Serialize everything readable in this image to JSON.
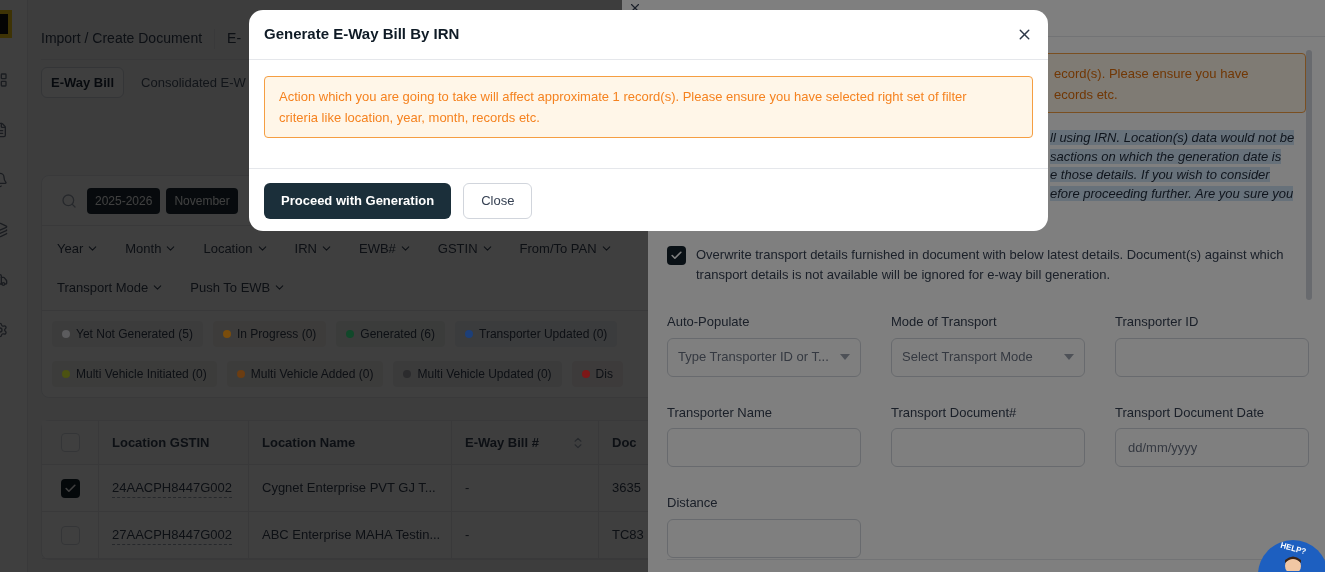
{
  "page": {
    "breadcrumb": [
      "Import / Create Document",
      "E-"
    ],
    "tabs": [
      {
        "label": "E-Way Bill",
        "selected": true
      },
      {
        "label": "Consolidated E-W",
        "selected": false
      }
    ],
    "search_chips": [
      "2025-2026",
      "November"
    ],
    "filters": [
      "Year",
      "Month",
      "Location",
      "IRN",
      "EWB#",
      "GSTIN",
      "From/To PAN",
      "Transport Mode",
      "Push To EWB"
    ],
    "statuses": [
      {
        "label": "Yet Not Generated (5)",
        "color": "#5c5c5e"
      },
      {
        "label": "In Progress (0)",
        "color": "#7a4d0c"
      },
      {
        "label": "Generated (6)",
        "color": "#11482a"
      },
      {
        "label": "Transporter Updated (0)",
        "color": "#1d3f78"
      },
      {
        "label": "Multi Vehicle Initiated (0)",
        "color": "#4c5212"
      },
      {
        "label": "Multi Vehicle Added (0)",
        "color": "#6b3d12"
      },
      {
        "label": "Multi Vehicle Updated (0)",
        "color": "#2b2b2d"
      },
      {
        "label": "Dis",
        "color": "#7d1818"
      }
    ],
    "table": {
      "header_checked": false,
      "columns": [
        {
          "label": "Location GSTIN",
          "sortable": false
        },
        {
          "label": "Location Name",
          "sortable": false
        },
        {
          "label": "E-Way Bill #",
          "sortable": true
        },
        {
          "label": "Doc",
          "sortable": false
        }
      ],
      "rows": [
        {
          "selected": true,
          "cells": [
            "24AACPH8447G002",
            "Cygnet Enterprise PVT GJ T...",
            "-",
            "3635"
          ]
        },
        {
          "selected": false,
          "cells": [
            "27AACPH8447G002",
            "ABC Enterprise MAHA Testin...",
            "-",
            "TC83"
          ]
        }
      ]
    }
  },
  "drawer": {
    "warning_lines": [
      "ecord(s). Please ensure you have",
      "ecords etc."
    ],
    "info_lines": [
      "ll using IRN. Location(s) data would not be",
      "sactions on which the generation date is",
      "e those details. If you wish to consider",
      "efore proceeding further. Are you sure you"
    ],
    "overwrite": {
      "checked": true,
      "text": "Overwrite transport details furnished in document with below latest details. Document(s) against which transport details is not available will be ignored for e-way bill generation."
    },
    "fields": [
      {
        "label": "Auto-Populate",
        "kind": "select",
        "placeholder": "Type Transporter ID or T..."
      },
      {
        "label": "Mode of Transport",
        "kind": "select",
        "placeholder": "Select Transport Mode"
      },
      {
        "label": "Transporter ID",
        "kind": "input"
      },
      {
        "label": "Transporter Name",
        "kind": "input"
      },
      {
        "label": "Transport Document#",
        "kind": "input"
      },
      {
        "label": "Transport Document Date",
        "kind": "input",
        "placeholder": "dd/mm/yyyy"
      },
      {
        "label": "Distance",
        "kind": "input"
      }
    ],
    "help": "HELP?"
  },
  "modal": {
    "title": "Generate E-Way Bill By IRN",
    "warning": "Action which you are going to take will affect approximate 1 record(s). Please ensure you have selected right set of filter criteria like location, year, month, records etc.",
    "buttons": [
      {
        "label": "Proceed with Generation",
        "kind": "primary"
      },
      {
        "label": "Close",
        "kind": "secondary"
      }
    ]
  }
}
